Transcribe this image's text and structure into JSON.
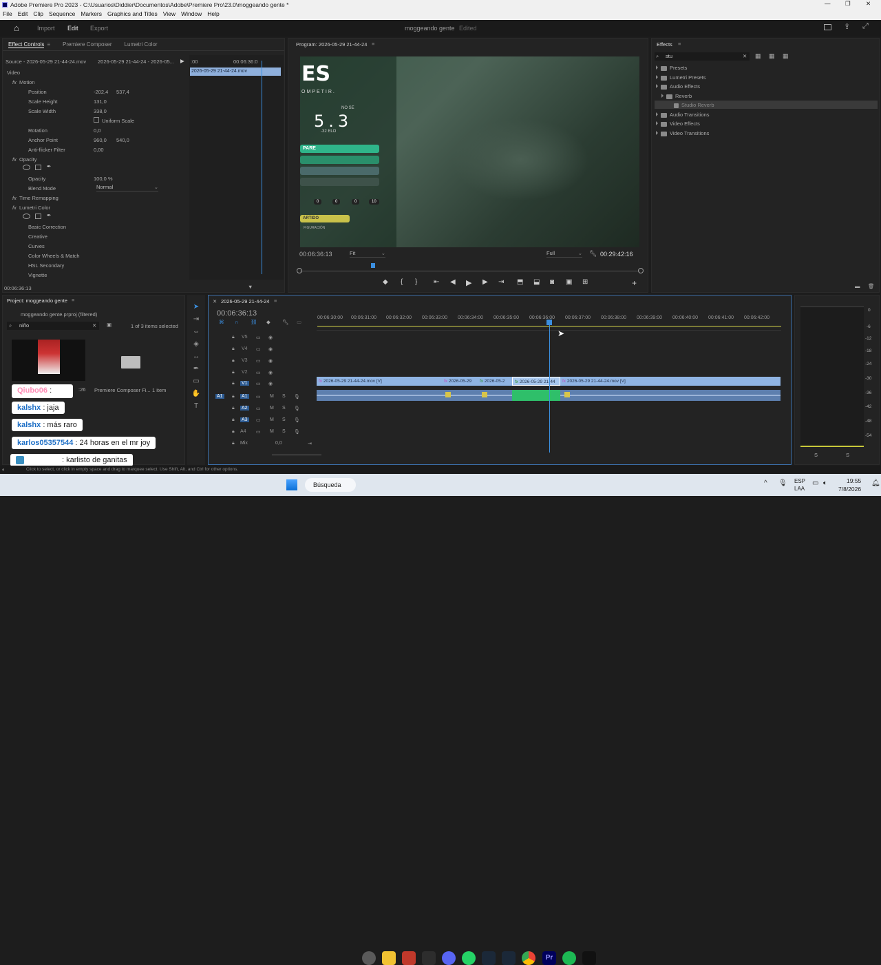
{
  "window": {
    "title": "Adobe Premiere Pro 2023 - C:\\Usuarios\\Diddier\\Documentos\\Adobe\\Premiere Pro\\23.0\\moggeando gente *"
  },
  "menu": [
    "File",
    "Edit",
    "Clip",
    "Sequence",
    "Markers",
    "Graphics and Titles",
    "View",
    "Window",
    "Help"
  ],
  "workspace": {
    "tabs": [
      "Import",
      "Edit",
      "Export"
    ],
    "active": "Edit",
    "project_name": "moggeando gente",
    "state": "Edited"
  },
  "effect_controls": {
    "tabs": [
      "Effect Controls",
      "Premiere Composer",
      "Lumetri Color"
    ],
    "source": "Source - 2026-05-29 21-44-24.mov",
    "sequence": "2026-05-29 21-44-24 - 2026-05...",
    "mini_time_start": ":00",
    "mini_time": "00:06:36:0",
    "mini_clip": "2026-05-29 21-44-24.mov",
    "video_label": "Video",
    "motion": "Motion",
    "position_label": "Position",
    "position_x": "-202,4",
    "position_y": "537,4",
    "scale_height_label": "Scale Height",
    "scale_height": "131,0",
    "scale_width_label": "Scale Width",
    "scale_width": "338,0",
    "uniform_scale": "Uniform Scale",
    "rotation_label": "Rotation",
    "rotation": "0,0",
    "anchor_label": "Anchor Point",
    "anchor_x": "960,0",
    "anchor_y": "540,0",
    "antiflicker_label": "Anti-flicker Filter",
    "antiflicker": "0,00",
    "opacity_section": "Opacity",
    "opacity_label": "Opacity",
    "opacity": "100,0 %",
    "blend_label": "Blend Mode",
    "blend": "Normal",
    "time_remap": "Time Remapping",
    "lumetri": "Lumetri Color",
    "lumetri_items": [
      "Basic Correction",
      "Creative",
      "Curves",
      "Color Wheels & Match",
      "HSL Secondary",
      "Vignette"
    ],
    "timecode": "00:06:36:13"
  },
  "program": {
    "title": "Program: 2026-05-29 21-44-24",
    "timecode": "00:06:36:13",
    "fit": "Fit",
    "quality": "Full",
    "duration": "00:29:42:16",
    "overlay_big": "ES",
    "overlay_sub": "OMPETIR.",
    "overlay_small": "NO SE",
    "overlay_num": "5.3",
    "overlay_elo": "-32 ELO",
    "overlay_btn": "PARE",
    "overlay_nums": [
      "0",
      "0",
      "0",
      "10"
    ],
    "overlay_bottom": "ARTIDO",
    "overlay_fine": "FIGURACIÓN"
  },
  "effects": {
    "title": "Effects",
    "search": "stu",
    "items": [
      "Presets",
      "Lumetri Presets",
      "Audio Effects",
      "Reverb",
      "Studio Reverb",
      "Audio Transitions",
      "Video Effects",
      "Video Transitions"
    ]
  },
  "project": {
    "title": "Project: moggeando gente",
    "file": "moggeando gente.prproj (filtered)",
    "search": "niño",
    "count": "1 of 3 items selected",
    "thumb_time": ":26",
    "folder_label": "Premiere Composer Fi...",
    "folder_count": "1 item"
  },
  "chat": [
    {
      "user": "Qiubo06",
      "msg": ":",
      "color": "#ff69b4"
    },
    {
      "user": "kalshx",
      "msg": ": jaja",
      "color": "#1e7fd6"
    },
    {
      "user": "kalshx",
      "msg": ": más raro",
      "color": "#1e7fd6"
    },
    {
      "user": "karlos05357544",
      "msg": ": 24 horas en el mr joy",
      "color": "#1e7fd6"
    },
    {
      "user": "",
      "msg": ": karlisto de ganitas",
      "color": "#1e7fd6"
    }
  ],
  "timeline": {
    "title": "2026-05-29 21-44-24",
    "timecode": "00:06:36:13",
    "ticks": [
      "00:06:30:00",
      "00:06:31:00",
      "00:06:32:00",
      "00:06:33:00",
      "00:06:34:00",
      "00:06:35:00",
      "00:06:36:00",
      "00:06:37:00",
      "00:06:38:00",
      "00:06:39:00",
      "00:06:40:00",
      "00:06:41:00",
      "00:06:42:00"
    ],
    "video_tracks": [
      "V5",
      "V4",
      "V3",
      "V2",
      "V1"
    ],
    "audio_tracks": [
      "A1",
      "A2",
      "A3",
      "A4"
    ],
    "mix": "Mix",
    "mix_val": "0,0",
    "clips": [
      "2026-05-29 21-44-24.mov [V]",
      "2026-05-29",
      "2026-05-2",
      "2026-05-29 21-44",
      "2026-05-29 21-44-24.mov [V]"
    ]
  },
  "meter": {
    "labels": [
      "0",
      "-6",
      "-12",
      "-18",
      "-24",
      "-30",
      "-36",
      "-42",
      "-48",
      "-54"
    ],
    "solo": [
      "S",
      "S"
    ]
  },
  "status": "Click to select, or click in empty space and drag to marquee select. Use Shift, Alt, and Ctrl for other options.",
  "taskbar": {
    "search": "Búsqueda",
    "lang": "ESP",
    "region": "LAA",
    "time": "19:55",
    "date": "7/8/2026"
  }
}
